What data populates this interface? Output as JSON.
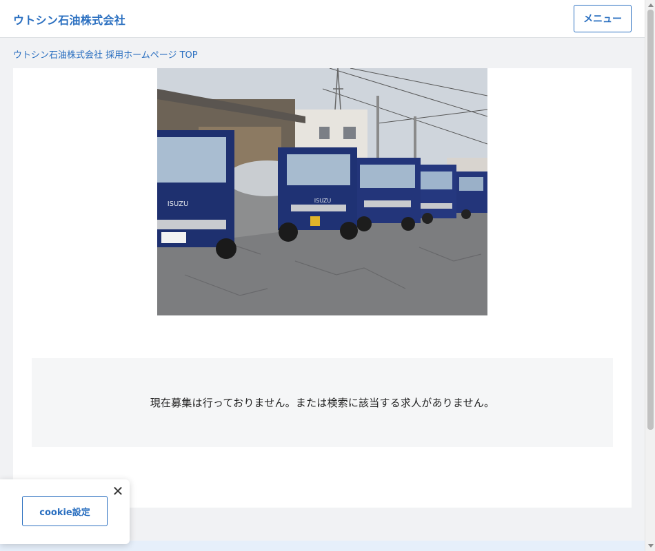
{
  "header": {
    "site_title": "ウトシン石油株式会社",
    "menu_label": "メニュー"
  },
  "breadcrumb": {
    "label": "ウトシン石油株式会社 採用ホームページ TOP"
  },
  "hero": {
    "image_description": "tanker-trucks-photo"
  },
  "notice": {
    "message": "現在募集は行っておりません。または検索に該当する求人がありません。"
  },
  "cookie": {
    "close_symbol": "✕",
    "settings_label": "cookie設定"
  },
  "colors": {
    "accent": "#2a6fc0",
    "page_bg": "#f1f2f4",
    "notice_bg": "#f5f6f7",
    "truck_blue": "#23357a"
  }
}
